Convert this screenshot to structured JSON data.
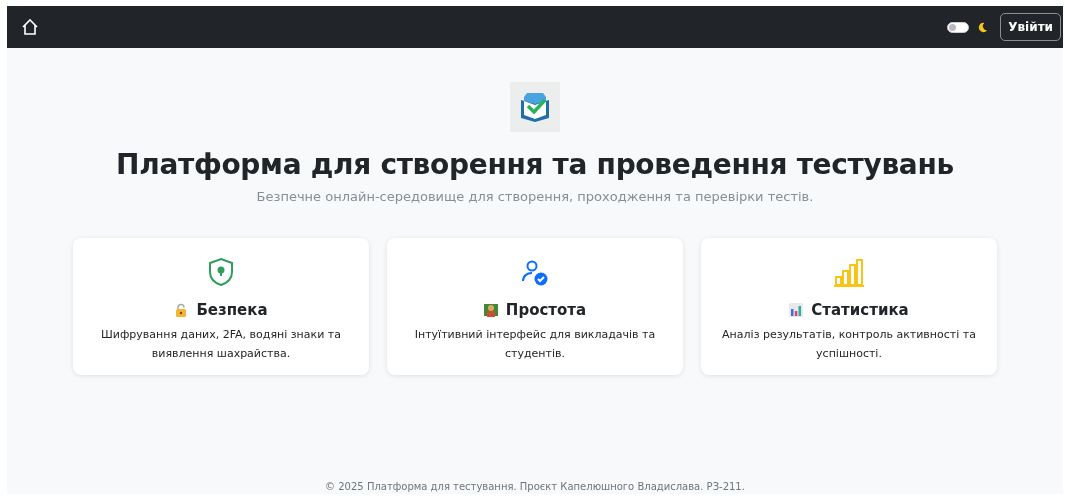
{
  "navbar": {
    "theme_toggle": {
      "on": false
    },
    "login_button": "Увійти"
  },
  "hero": {
    "title": "Платформа для створення та проведення тестувань",
    "subtitle": "Безпечне онлайн-середовище для створення, проходження та перевірки тестів."
  },
  "features": [
    {
      "kind": "shield",
      "title": "Безпека",
      "text": "Шифрування даних, 2FA, водяні знаки та виявлення шахрайства."
    },
    {
      "kind": "user",
      "title": "Простота",
      "text": "Інтуїтивний інтерфейс для викладачів та студентів."
    },
    {
      "kind": "stats",
      "title": "Статистика",
      "text": "Аналіз результатів, контроль активності та успішності."
    }
  ],
  "footer": "© 2025 Платформа для тестування. Проєкт Капелюшного Владислава. РЗ-211."
}
